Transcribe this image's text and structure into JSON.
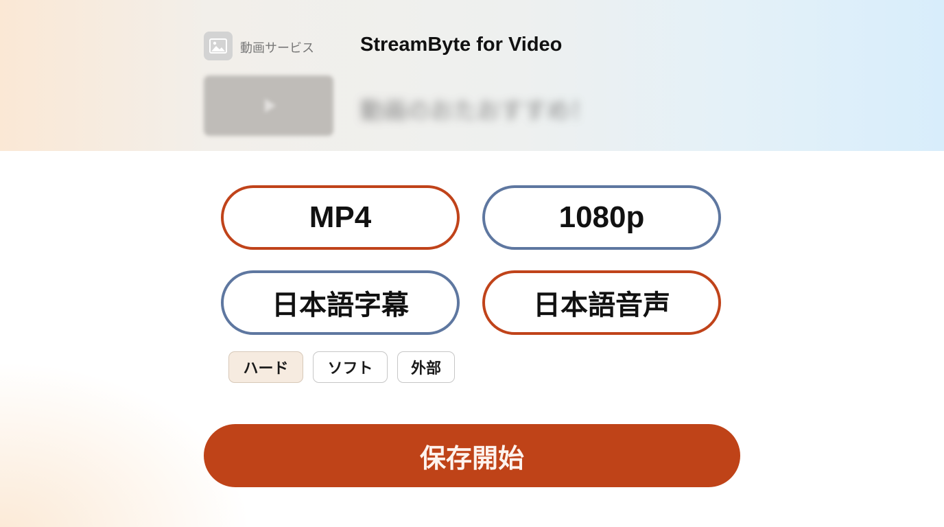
{
  "header": {
    "service_icon": "image-icon",
    "service_label": "動画サービス",
    "app_title": "StreamByte for Video",
    "promo_text_blurred": "動画のおたおすすめ！"
  },
  "options": {
    "format": "MP4",
    "resolution": "1080p",
    "subtitles": "日本語字幕",
    "audio": "日本語音声"
  },
  "subtitle_modes": {
    "items": [
      "ハード",
      "ソフト",
      "外部"
    ],
    "selected": "ハード"
  },
  "actions": {
    "start_label": "保存開始"
  },
  "colors": {
    "accent_orange": "#c0431a",
    "accent_blue": "#5e77a0",
    "start_button": "#bf4318"
  }
}
